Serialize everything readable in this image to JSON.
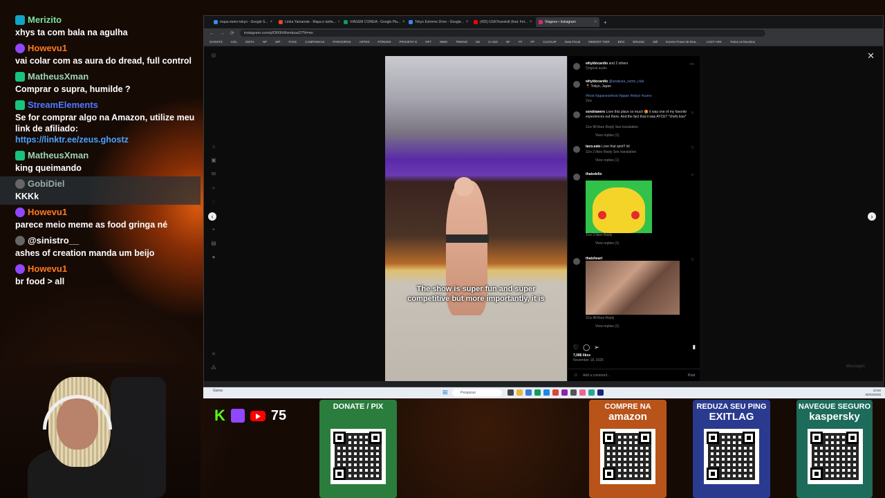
{
  "chat": {
    "messages": [
      {
        "user": "Merizito",
        "badge": "b-cyan",
        "name_class": "c-green",
        "text": "xhys ta com bala na agulha",
        "highlight": false
      },
      {
        "user": "Howevu1",
        "badge": "b-purple",
        "name_class": "c-orange",
        "text": "vai colar com as aura do dread, full control",
        "highlight": false
      },
      {
        "user": "MatheusXman",
        "badge": "b-green",
        "name_class": "c-teal",
        "text": "Comprar o supra, humilde ?",
        "highlight": false
      },
      {
        "user": "StreamElements",
        "badge": "b-green",
        "name_class": "c-blue",
        "text": "Se for comprar algo na Amazon, utilize meu link de afiliado:",
        "link": "https://linktr.ee/zeus.ghostz",
        "highlight": false
      },
      {
        "user": "MatheusXman",
        "badge": "b-green",
        "name_class": "c-teal",
        "text": "king queimando",
        "highlight": false
      },
      {
        "user": "GobiDiel",
        "badge": "b-gray",
        "name_class": "c-gray",
        "text": "KKKk",
        "highlight": true
      },
      {
        "user": "Howevu1",
        "badge": "b-purple",
        "name_class": "c-orange",
        "text": "parece meio meme as food gringa né",
        "highlight": false
      },
      {
        "user": "@sinistro__",
        "badge": "b-gray",
        "name_class": "c-white",
        "text": "ashes of creation manda um beijo",
        "highlight": false
      },
      {
        "user": "Howevu1",
        "badge": "b-purple",
        "name_class": "c-orange",
        "text": "br food > all",
        "highlight": false
      }
    ]
  },
  "browser": {
    "tabs": [
      {
        "label": "mapa metro tokyo - Google S...",
        "color": "#4285f4",
        "active": false
      },
      {
        "label": "Linha Yamanote - Mapa e tarifa...",
        "color": "#e04a2a",
        "active": false
      },
      {
        "label": "VIAGEM COREIA - Google Pla...",
        "color": "#0f9d58",
        "active": false
      },
      {
        "label": "Tokyo Extreme Drive - Google...",
        "color": "#4285f4",
        "active": false
      },
      {
        "label": "(425) USA7travels8 (feat. Fel...",
        "color": "#ff0000",
        "active": false
      },
      {
        "label": "Viagens • Instagram",
        "color": "#d62976",
        "active": true
      }
    ],
    "url": "instagram.com/p/DR0hWxmkuwZ/?hl=en",
    "bookmarks": [
      "GHOSTZ",
      "COL",
      "DIETA",
      "NP",
      "WP",
      "FACE",
      "CAMPANHAS",
      "PARCEIROS",
      "ARTES",
      "FÓRUNS",
      "PROJETO G",
      "NFT",
      "MMO",
      "TREINO",
      "Ms",
      "G ADS",
      "NF",
      "FF",
      "FP",
      "CLICKUP",
      "Nota Fiscal",
      "REBOOT TIER",
      "BDO",
      "ERLING",
      "dell",
      "Evento Power BI Rea...",
      "LOST ARK",
      "Todos os favoritos"
    ]
  },
  "video": {
    "caption": "The show is super fun and super competitive but more importantly, it is"
  },
  "post": {
    "author": "whyidocardio",
    "author_suffix": "and 2 others",
    "audio": "Original audio",
    "caption_user": "whyidocardio",
    "caption_mention": "@asakusa_sumo_club",
    "caption_location": "📍 Tokyo, Japan",
    "hashtags": "#food #japanesefood #japan #tokyo #sumo",
    "caption_age": "11w",
    "comments": [
      {
        "user": "sondrawers",
        "text": "Love this place so much 😍 it was one of my favorite experiences out there. And the fact that it was AYCE? *chefs kiss*",
        "meta": "11w  98 likes  Reply  See translation",
        "replies": "View replies (1)"
      },
      {
        "user": "taco.eats",
        "text": "Love that spot!! lol",
        "meta": "11w  2 likes  Reply  See translation",
        "replies": "View replies (1)"
      },
      {
        "user": "thatsdelio",
        "text": "",
        "meta": "11w  3 likes  Reply",
        "replies": "View replies (1)"
      },
      {
        "user": "thatsheart",
        "text": "",
        "meta": "11w  48 likes  Reply",
        "replies": "View replies (1)"
      }
    ],
    "likes": "7,086 likes",
    "date": "November 18, 2025",
    "comment_placeholder": "Add a comment...",
    "post_label": "Post",
    "messages_label": "Messages"
  },
  "taskbar": {
    "weather": "Garoa",
    "search": "Pesquisar",
    "time": "23:50",
    "date": "05/03/2026"
  },
  "overlay": {
    "viewers": "75",
    "cards": [
      {
        "title": "DONATE / PIX",
        "brand": "",
        "bg": "#2b7d3d",
        "brand_color": "#fff"
      },
      {
        "title": "COMPRE NA",
        "brand": "amazon",
        "bg": "#b8541a",
        "brand_color": "#fff"
      },
      {
        "title": "REDUZA SEU PING",
        "brand": "EXITLAG",
        "bg": "#2a3a8f",
        "brand_color": "#fff"
      },
      {
        "title": "NAVEGUE SEGURO",
        "brand": "kaspersky",
        "bg": "#1d6b5a",
        "brand_color": "#fff"
      }
    ]
  }
}
